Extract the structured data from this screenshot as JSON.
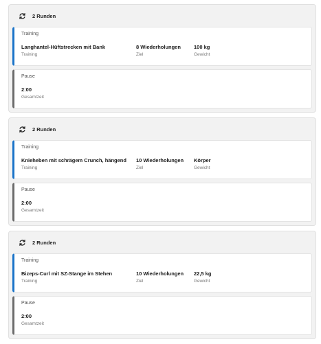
{
  "groups": [
    {
      "rounds": "2 Runden",
      "training": {
        "tag": "Training",
        "exercise": "Langhantel-Hüftstrecken mit Bank",
        "exercise_sub": "Training",
        "target": "8 Wiederholungen",
        "target_sub": "Ziel",
        "weight": "100 kg",
        "weight_sub": "Gewicht"
      },
      "pause": {
        "tag": "Pause",
        "time": "2:00",
        "time_sub": "Gesamtzeit"
      }
    },
    {
      "rounds": "2 Runden",
      "training": {
        "tag": "Training",
        "exercise": "Knieheben mit schrägem Crunch, hängend",
        "exercise_sub": "Training",
        "target": "10 Wiederholungen",
        "target_sub": "Ziel",
        "weight": "Körper",
        "weight_sub": "Gewicht"
      },
      "pause": {
        "tag": "Pause",
        "time": "2:00",
        "time_sub": "Gesamtzeit"
      }
    },
    {
      "rounds": "2 Runden",
      "training": {
        "tag": "Training",
        "exercise": "Bizeps-Curl mit SZ-Stange im Stehen",
        "exercise_sub": "Training",
        "target": "10 Wiederholungen",
        "target_sub": "Ziel",
        "weight": "22,5 kg",
        "weight_sub": "Gewicht"
      },
      "pause": {
        "tag": "Pause",
        "time": "2:00",
        "time_sub": "Gesamtzeit"
      }
    }
  ],
  "icons": {
    "repeat": "repeat-icon"
  },
  "colors": {
    "training_accent": "#1a73c8",
    "pause_accent": "#6b6b6b",
    "group_background": "#f2f2f2"
  }
}
